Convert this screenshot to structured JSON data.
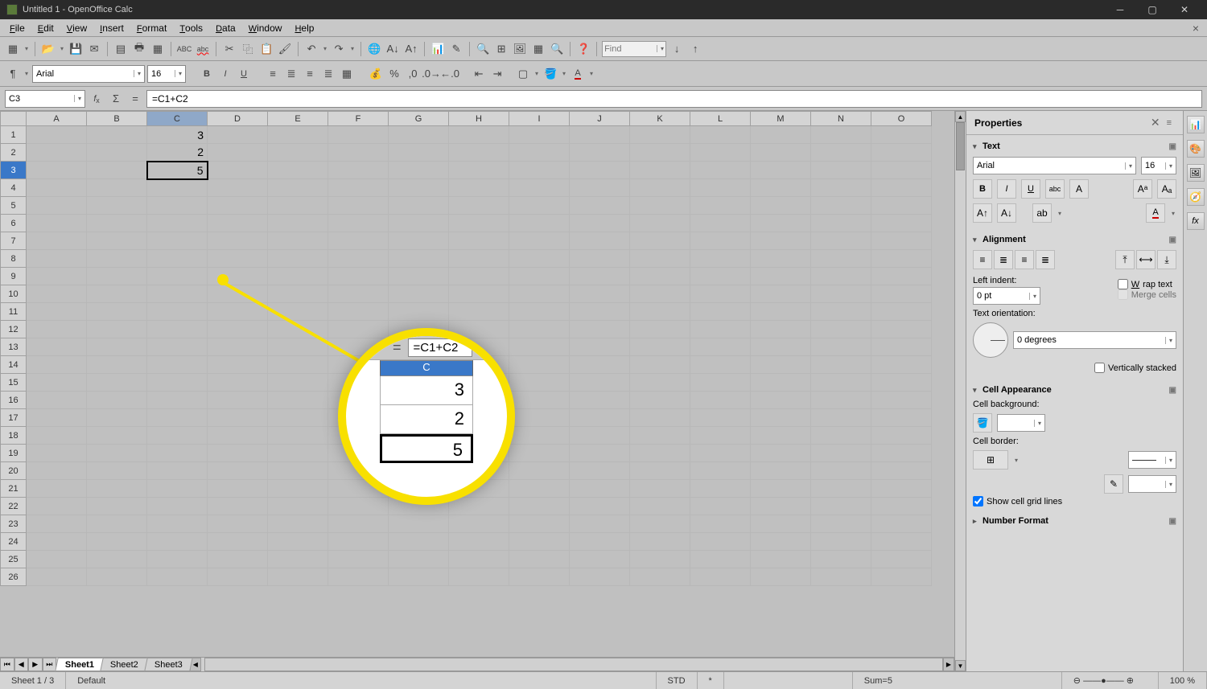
{
  "title": "Untitled 1 - OpenOffice Calc",
  "menu": [
    "File",
    "Edit",
    "View",
    "Insert",
    "Format",
    "Tools",
    "Data",
    "Window",
    "Help"
  ],
  "find_placeholder": "Find",
  "font": {
    "name": "Arial",
    "size": "16"
  },
  "name_box": "C3",
  "formula": "=C1+C2",
  "columns": [
    "A",
    "B",
    "C",
    "D",
    "E",
    "F",
    "G",
    "H",
    "I",
    "J",
    "K",
    "L",
    "M",
    "N",
    "O"
  ],
  "row_count": 26,
  "active_col": "C",
  "active_row": 3,
  "cells": {
    "C1": "3",
    "C2": "2",
    "C3": "5"
  },
  "sheets": [
    "Sheet1",
    "Sheet2",
    "Sheet3"
  ],
  "active_sheet": "Sheet1",
  "status": {
    "sheet": "Sheet 1 / 3",
    "style": "Default",
    "mode": "STD",
    "modified": "*",
    "sum": "Sum=5",
    "zoom": "100 %"
  },
  "props": {
    "title": "Properties",
    "text": {
      "header": "Text",
      "font": "Arial",
      "size": "16"
    },
    "alignment": {
      "header": "Alignment",
      "left_indent_label": "Left indent:",
      "left_indent": "0 pt",
      "wrap": "Wrap text",
      "merge": "Merge cells",
      "orient_label": "Text orientation:",
      "degrees": "0 degrees",
      "vstack": "Vertically stacked"
    },
    "appearance": {
      "header": "Cell Appearance",
      "bg_label": "Cell background:",
      "border_label": "Cell border:",
      "grid": "Show cell grid lines"
    },
    "number": {
      "header": "Number Format"
    }
  },
  "magnifier": {
    "formula": "=C1+C2",
    "col": "C",
    "v1": "3",
    "v2": "2",
    "v3": "5"
  }
}
